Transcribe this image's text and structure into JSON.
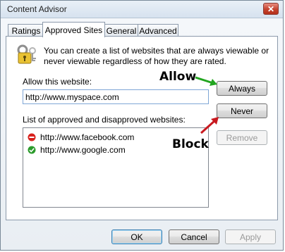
{
  "window": {
    "title": "Content Advisor"
  },
  "tabs": [
    {
      "label": "Ratings"
    },
    {
      "label": "Approved Sites"
    },
    {
      "label": "General"
    },
    {
      "label": "Advanced"
    }
  ],
  "panel": {
    "description": "You can create a list of websites that are always viewable or never viewable regardless of how they are rated.",
    "allow_label": "Allow this website:",
    "url_value": "http://www.myspace.com",
    "list_label": "List of approved and disapproved websites:",
    "sites": [
      {
        "url": "http://www.facebook.com",
        "status": "never",
        "icon": "blocked-icon"
      },
      {
        "url": "http://www.google.com",
        "status": "always",
        "icon": "approved-icon"
      }
    ],
    "buttons": {
      "always": "Always",
      "never": "Never",
      "remove": "Remove"
    }
  },
  "annotations": {
    "allow": "Allow",
    "block": "Block"
  },
  "footer": {
    "ok": "OK",
    "cancel": "Cancel",
    "apply": "Apply"
  },
  "colors": {
    "allow_arrow": "#22a51f",
    "block_arrow": "#c8191f",
    "blocked": "#d8211d",
    "approved": "#2c9b2c"
  }
}
